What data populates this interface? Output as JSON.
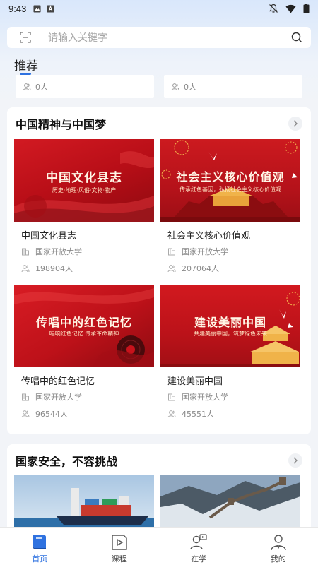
{
  "status_bar": {
    "time": "9:43"
  },
  "search": {
    "placeholder": "请输入关键字"
  },
  "recommend": {
    "title": "推荐",
    "cards": [
      {
        "count": "0人"
      },
      {
        "count": "0人"
      }
    ]
  },
  "sections": [
    {
      "title": "中国精神与中国梦",
      "courses": [
        {
          "thumb_title": "中国文化县志",
          "thumb_sub": "历史·地理·风俗·文物·物产",
          "title": "中国文化县志",
          "school": "国家开放大学",
          "learners": "198904人"
        },
        {
          "thumb_title": "社会主义核心价值观",
          "thumb_sub": "传承红色基因，弘扬社会主义核心价值观",
          "title": "社会主义核心价值观",
          "school": "国家开放大学",
          "learners": "207064人"
        },
        {
          "thumb_title": "传唱中的红色记忆",
          "thumb_sub": "唱响红色记忆 传承革命精神",
          "title": "传唱中的红色记忆",
          "school": "国家开放大学",
          "learners": "96544人"
        },
        {
          "thumb_title": "建设美丽中国",
          "thumb_sub": "共建美丽中国，筑梦绿色未来",
          "title": "建设美丽中国",
          "school": "国家开放大学",
          "learners": "45551人"
        }
      ]
    },
    {
      "title": "国家安全，不容挑战"
    }
  ],
  "bottom_nav": [
    {
      "label": "首页",
      "icon": "book-icon"
    },
    {
      "label": "课程",
      "icon": "video-icon"
    },
    {
      "label": "在学",
      "icon": "learner-icon"
    },
    {
      "label": "我的",
      "icon": "profile-icon"
    }
  ],
  "colors": {
    "accent": "#2f72e0",
    "thumb_red": "#c8121b"
  }
}
